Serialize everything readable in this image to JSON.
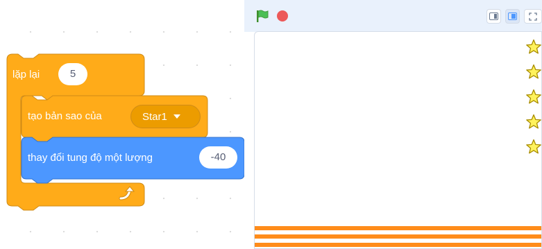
{
  "code": {
    "repeat_block": {
      "label": "lặp lại",
      "times": "5"
    },
    "clone_block": {
      "label": "tạo bản sao của",
      "target": "Star1"
    },
    "change_y_block": {
      "label": "thay đổi tung độ một lượng",
      "value": "-40"
    },
    "loop_arrow_icon": "loop-arrow-icon"
  },
  "stage": {
    "header": {
      "icons": [
        "green-flag-icon",
        "stop-icon",
        "small-stage-icon",
        "normal-stage-icon",
        "fullscreen-icon"
      ]
    },
    "sprites": {
      "icon": "star-icon",
      "count": 5
    }
  },
  "colors": {
    "control": "#ffab19",
    "control_dark": "#cf8b17",
    "motion": "#4c97ff",
    "motion_dark": "#3373cc",
    "stripe": "#ff8c1a",
    "stage_header": "#e9f1fc"
  }
}
